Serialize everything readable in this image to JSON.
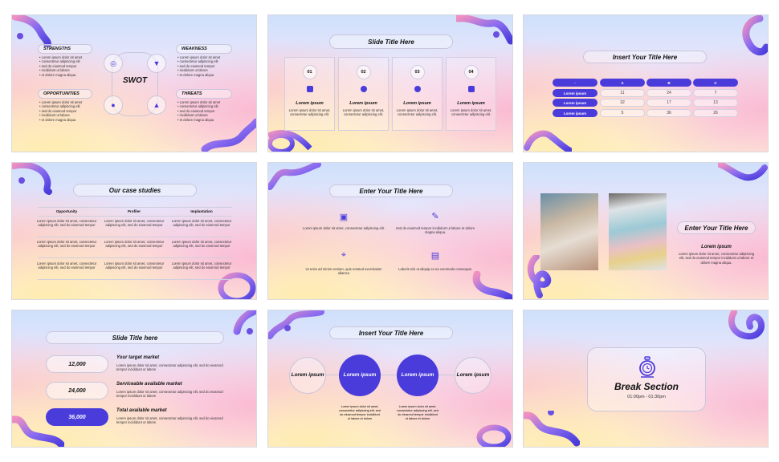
{
  "slides": {
    "swot": {
      "center_label": "SWOT",
      "quadrants": [
        {
          "title": "STRENGTHS",
          "icon": "target-icon",
          "bullets": [
            "Lorem ipsum dolor sit amet",
            "consectetur adipiscing elit",
            "sed do eiusmod tempor",
            "incididunt ut labore",
            "et dolore magna aliqua"
          ]
        },
        {
          "title": "WEAKNESS",
          "icon": "thumbs-down-icon",
          "bullets": [
            "Lorem ipsum dolor sit amet",
            "consectetur adipiscing elit",
            "sed do eiusmod tempor",
            "incididunt ut labore",
            "et dolore magna aliqua"
          ]
        },
        {
          "title": "OPPORTUNITIES",
          "icon": "lightbulb-icon",
          "bullets": [
            "Lorem ipsum dolor sit amet",
            "consectetur adipiscing elit",
            "sed do eiusmod tempor",
            "incididunt ut labore",
            "et dolore magna aliqua"
          ]
        },
        {
          "title": "THREATS",
          "icon": "warning-icon",
          "bullets": [
            "Lorem ipsum dolor sit amet",
            "consectetur adipiscing elit",
            "sed do eiusmod tempor",
            "incididunt ut labore",
            "et dolore magna aliqua"
          ]
        }
      ]
    },
    "four_cards": {
      "title": "Slide Title Here",
      "cards": [
        {
          "number": "01",
          "icon": "camera-icon",
          "title": "Lorem ipsum",
          "text": "Lorem ipsum dolor sit amet, consectetur adipiscing elit."
        },
        {
          "number": "02",
          "icon": "badge-icon",
          "title": "Lorem ipsum",
          "text": "Lorem ipsum dolor sit amet, consectetur adipiscing elit."
        },
        {
          "number": "03",
          "icon": "globe-icon",
          "title": "Lorem ipsum",
          "text": "Lorem ipsum dolor sit amet, consectetur adipiscing elit."
        },
        {
          "number": "04",
          "icon": "swap-icon",
          "title": "Lorem ipsum",
          "text": "Lorem ipsum dolor sit amet, consectetur adipiscing elit."
        }
      ]
    },
    "table": {
      "title": "Insert Your Title Here",
      "headers": [
        "-",
        "A",
        "B",
        "C"
      ],
      "rows": [
        {
          "label": "Lorem ipsum",
          "values": [
            "11",
            "24",
            "7"
          ]
        },
        {
          "label": "Lorem ipsum",
          "values": [
            "32",
            "17",
            "13"
          ]
        },
        {
          "label": "Lorem ipsum",
          "values": [
            "5",
            "36",
            "26"
          ]
        }
      ]
    },
    "case_studies": {
      "title": "Our case studies",
      "columns": [
        "Opportunity",
        "Profiler",
        "Implantation"
      ],
      "cell_text": "Lorem ipsum dolor sit amet, consectetur adipiscing elit, sed do eiusmod tempor"
    },
    "features": {
      "title": "Enter Your Title Here",
      "items": [
        {
          "icon": "calendar-icon",
          "text": "Lorem ipsum dolor sit amet, consectetur adipiscing elit."
        },
        {
          "icon": "pencil-icon",
          "text": "Sed do eiusmod tempor incididunt ut labore et dolore magna aliqua."
        },
        {
          "icon": "route-pin-icon",
          "text": "Ut enim ad minim veniam, quis nostrud exercitation ullamco"
        },
        {
          "icon": "document-edit-icon",
          "text": "Laboris nisi ut aliquip ex ea commodo consequat."
        }
      ]
    },
    "photos": {
      "title": "Enter Your Title Here",
      "subtitle": "Lorem ipsum",
      "text": "Lorem ipsum dolor sit amet, consectetur adipiscing elit, sed do eiusmod tempor incididunt ut labore et dolore magna aliqua."
    },
    "market": {
      "title": "Slide Title here",
      "items": [
        {
          "value": "12,000",
          "label": "Your target market",
          "text": "Lorem ipsum dolor sit amet, consectetur adipiscing elit, sed do eiusmod tempor incididunt ut labore",
          "active": false
        },
        {
          "value": "24,000",
          "label": "Serviceable available market",
          "text": "Lorem ipsum dolor sit amet, consectetur adipiscing elit, sed do eiusmod tempor incididunt ut labore",
          "active": false
        },
        {
          "value": "36,000",
          "label": "Total available market",
          "text": "Lorem ipsum dolor sit amet, consectetur adipiscing elit, sed do eiusmod tempor incididunt ut labore",
          "active": true
        }
      ]
    },
    "timeline": {
      "title": "Insert Your Title Here",
      "nodes": [
        "Lorem ipsum",
        "Lorem ipsum",
        "Lorem ipsum",
        "Lorem ipsum"
      ],
      "texts": [
        "Lorem ipsum dolor sit amet, consectetur adipiscing elit, sed do eiusmod tempor incididunt ut labore et dolore",
        "Lorem ipsum dolor sit amet, consectetur adipiscing elit, sed do eiusmod tempor incididunt ut labore et dolore"
      ]
    },
    "break": {
      "title": "Break Section",
      "time": "01:00pm - 01:30pm",
      "icon": "stopwatch-icon"
    }
  },
  "colors": {
    "accent": "#4a3bdb",
    "text": "#111111",
    "border": "#c9c6dc"
  }
}
